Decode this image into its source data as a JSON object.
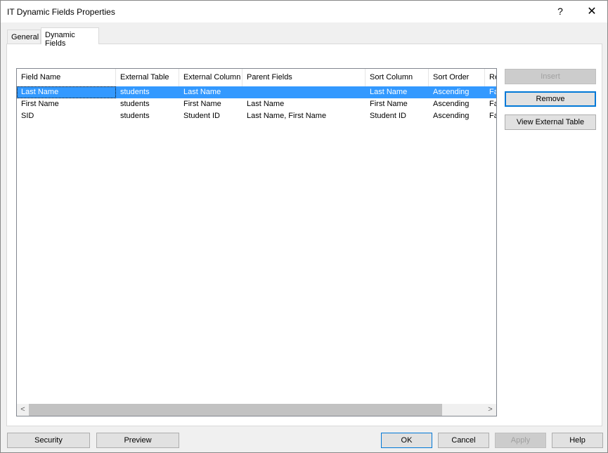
{
  "window": {
    "title": "IT Dynamic Fields Properties"
  },
  "titlebar": {
    "help": "?",
    "close": "✕"
  },
  "tabs": [
    {
      "label": "General"
    },
    {
      "label": "Dynamic Fields"
    }
  ],
  "table": {
    "columns": [
      "Field Name",
      "External Table",
      "External Column",
      "Parent Fields",
      "Sort Column",
      "Sort Order",
      "Re"
    ],
    "rows": [
      [
        "Last Name",
        "students",
        "Last Name",
        "",
        "Last Name",
        "Ascending",
        "Fa"
      ],
      [
        "First Name",
        "students",
        "First Name",
        "Last Name",
        "First Name",
        "Ascending",
        "Fa"
      ],
      [
        "SID",
        "students",
        "Student ID",
        "Last Name, First Name",
        "Student ID",
        "Ascending",
        "Fa"
      ]
    ]
  },
  "side_buttons": {
    "insert": "Insert",
    "remove": "Remove",
    "view_external": "View External Table"
  },
  "footer_buttons": {
    "security": "Security",
    "preview": "Preview",
    "ok": "OK",
    "cancel": "Cancel",
    "apply": "Apply",
    "help": "Help"
  },
  "scroll": {
    "left": "<",
    "right": ">"
  }
}
